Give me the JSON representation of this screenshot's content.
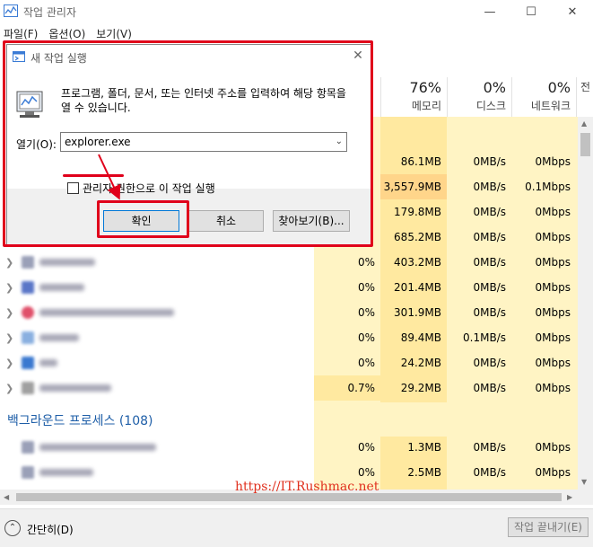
{
  "window": {
    "title": "작업 관리자",
    "minimize": "—",
    "maximize": "☐",
    "close": "✕"
  },
  "menu": [
    "파일(F)",
    "옵션(O)",
    "보기(V)"
  ],
  "columns": [
    {
      "pct": "76%",
      "label": "메모리"
    },
    {
      "pct": "0%",
      "label": "디스크"
    },
    {
      "pct": "0%",
      "label": "네트워크"
    },
    {
      "pct": "",
      "label": "전"
    }
  ],
  "rows": [
    {
      "cpu": "",
      "mem": "86.1MB",
      "disk": "0MB/s",
      "net": "0Mbps"
    },
    {
      "cpu": "",
      "mem": "3,557.9MB",
      "disk": "0MB/s",
      "net": "0.1Mbps"
    },
    {
      "cpu": "",
      "mem": "179.8MB",
      "disk": "0MB/s",
      "net": "0Mbps"
    },
    {
      "cpu": "",
      "mem": "685.2MB",
      "disk": "0MB/s",
      "net": "0Mbps"
    },
    {
      "cpu": "0%",
      "mem": "403.2MB",
      "disk": "0MB/s",
      "net": "0Mbps"
    },
    {
      "cpu": "0%",
      "mem": "201.4MB",
      "disk": "0MB/s",
      "net": "0Mbps"
    },
    {
      "cpu": "0%",
      "mem": "301.9MB",
      "disk": "0MB/s",
      "net": "0Mbps"
    },
    {
      "cpu": "0%",
      "mem": "89.4MB",
      "disk": "0.1MB/s",
      "net": "0Mbps"
    },
    {
      "cpu": "0%",
      "mem": "24.2MB",
      "disk": "0MB/s",
      "net": "0Mbps"
    },
    {
      "cpu": "0.7%",
      "mem": "29.2MB",
      "disk": "0MB/s",
      "net": "0Mbps"
    }
  ],
  "background_section": "백그라운드 프로세스 (108)",
  "bg_rows": [
    {
      "cpu": "0%",
      "mem": "1.3MB",
      "disk": "0MB/s",
      "net": "0Mbps"
    },
    {
      "cpu": "0%",
      "mem": "2.5MB",
      "disk": "0MB/s",
      "net": "0Mbps"
    }
  ],
  "footer": {
    "collapse": "간단히(D)",
    "end_task": "작업 끝내기(E)"
  },
  "watermark": "https://IT.Rushmac.net",
  "run_dialog": {
    "title": "새 작업 실행",
    "description": "프로그램, 폴더, 문서, 또는 인터넷 주소를 입력하여 해당 항목을 열 수 있습니다.",
    "open_label": "열기(O):",
    "open_value": "explorer.exe",
    "admin_checkbox": "관리자 권한으로 이 작업 실행",
    "ok": "확인",
    "cancel": "취소",
    "browse": "찾아보기(B)..."
  },
  "colors": {
    "highlight": "#e0001b",
    "accent": "#0078d7",
    "section_title": "#1f5fa8"
  }
}
